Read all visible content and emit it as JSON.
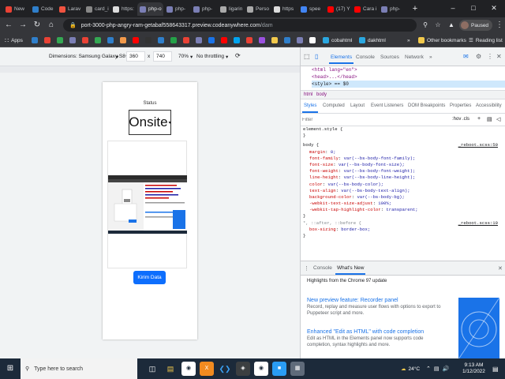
{
  "browser": {
    "tabs": [
      {
        "title": "New",
        "color": "#e94235"
      },
      {
        "title": "Code",
        "color": "#2f7fcb"
      },
      {
        "title": "Larav",
        "color": "#f05340"
      },
      {
        "title": "card_i",
        "color": "#888888"
      },
      {
        "title": "https:",
        "color": "#dddddd"
      },
      {
        "title": "php-o",
        "color": "#7b7fb5"
      },
      {
        "title": "php-",
        "color": "#7b7fb5"
      },
      {
        "title": "php-",
        "color": "#7b7fb5"
      },
      {
        "title": "ligarin",
        "color": "#aaaaaa"
      },
      {
        "title": "Perso",
        "color": "#aaaaaa"
      },
      {
        "title": "https",
        "color": "#dddddd"
      },
      {
        "title": "spee",
        "color": "#4285f4"
      },
      {
        "title": "(17) Y",
        "color": "#ff0000"
      },
      {
        "title": "Cara i",
        "color": "#ff0000"
      },
      {
        "title": "php-",
        "color": "#7b7fb5"
      }
    ],
    "url_host": "port-3000-php-angry-ram-getabaf558643317.preview.codeanywhere.com",
    "url_path": "/dam",
    "profile_label": "Paused",
    "bookmarks": [
      "Apps",
      "cobahtml",
      "dakhtml"
    ],
    "other_bookmarks": "Other bookmarks",
    "reading_list": "Reading list"
  },
  "device_toolbar": {
    "dimensions_label": "Dimensions: Samsung Galaxy S8+",
    "width": "360",
    "times": "x",
    "height": "740",
    "zoom": "70%",
    "throttling": "No throttling"
  },
  "app": {
    "status_label": "Status",
    "status_value": "Onsite",
    "submit_label": "Kirim Data"
  },
  "devtools": {
    "tabs": [
      "Elements",
      "Console",
      "Sources",
      "Network"
    ],
    "dom_lines": [
      "<html lang=\"en\">",
      "<head>...</head>",
      "<style> == $0"
    ],
    "crumbs": [
      "html",
      "body"
    ],
    "subtabs": [
      "Styles",
      "Computed",
      "Layout",
      "Event Listeners",
      "DOM Breakpoints",
      "Properties",
      "Accessibility"
    ],
    "filter_placeholder": "Filter",
    "filter_tools": ":hov .cls",
    "element_style": "element.style {",
    "body_selector": "body {",
    "body_source": "_reboot.scss:50",
    "body_props": [
      {
        "name": "margin",
        "value": "0;"
      },
      {
        "name": "font-family",
        "value": "var(--bs-body-font-family);"
      },
      {
        "name": "font-size",
        "value": "var(--bs-body-font-size);"
      },
      {
        "name": "font-weight",
        "value": "var(--bs-body-font-weight);"
      },
      {
        "name": "line-height",
        "value": "var(--bs-body-line-height);"
      },
      {
        "name": "color",
        "value": "var(--bs-body-color);"
      },
      {
        "name": "text-align",
        "value": "var(--bs-body-text-align);"
      },
      {
        "name": "background-color",
        "value": "var(--bs-body-bg);"
      },
      {
        "name": "-webkit-text-size-adjust",
        "value": "100%;"
      },
      {
        "name": "-webkit-tap-highlight-color",
        "value": "transparent;"
      }
    ],
    "star_selector": "*, ::after, ::before {",
    "star_source": "_reboot.scss:19",
    "star_prop": {
      "name": "box-sizing",
      "value": "border-box;"
    },
    "close_brace": "}",
    "drawer_tabs": [
      "Console",
      "What's New"
    ],
    "whats_new_header": "Highlights from the Chrome 97 update",
    "news": [
      {
        "title": "New preview feature: Recorder panel",
        "desc": "Record, replay and measure user flows with options to export to Puppeteer script and more."
      },
      {
        "title": "Enhanced \"Edit as HTML\" with code completion",
        "desc": "Edit as HTML in the Elements panel now supports code completion, syntax highlights and more."
      }
    ]
  },
  "taskbar": {
    "search_placeholder": "Type here to search",
    "weather": "24°C",
    "time": "9:13 AM",
    "date": "1/12/2022"
  }
}
